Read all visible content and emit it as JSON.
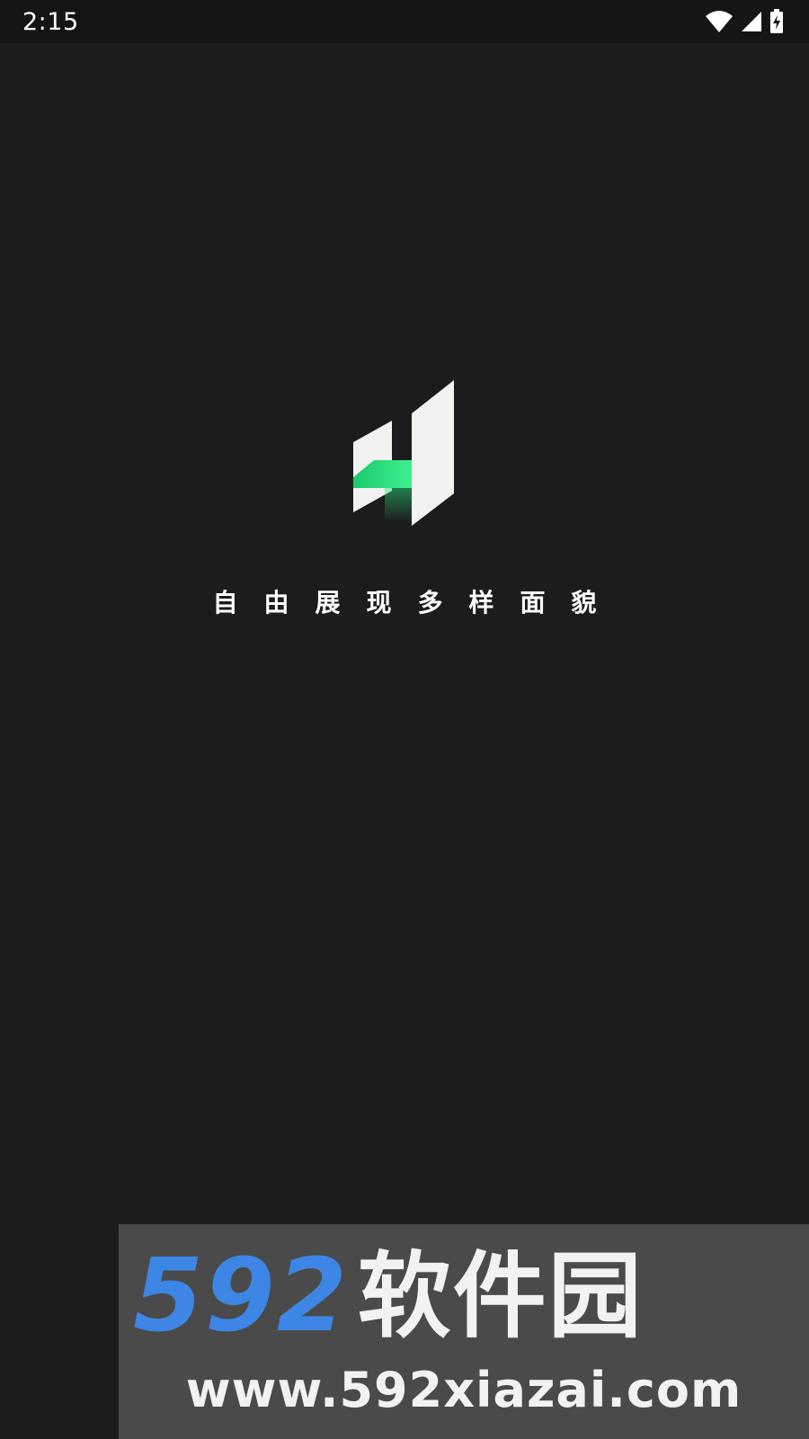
{
  "status_bar": {
    "time": "2:15",
    "icons": [
      "wifi-icon",
      "signal-icon",
      "battery-charging-icon"
    ]
  },
  "splash": {
    "logo": "app-logo",
    "tagline": "自由展现多样面貌"
  },
  "watermark": {
    "brand_digits": "592",
    "brand_name": "软件园",
    "url": "www.592xiazai.com"
  },
  "colors": {
    "background": "#1b1c1e",
    "status_bar": "#141517",
    "logo_white": "#f2f3f0",
    "logo_green": "#2ee37f",
    "watermark_bg": "#4a4a4a",
    "watermark_blue": "#3d86e6"
  }
}
